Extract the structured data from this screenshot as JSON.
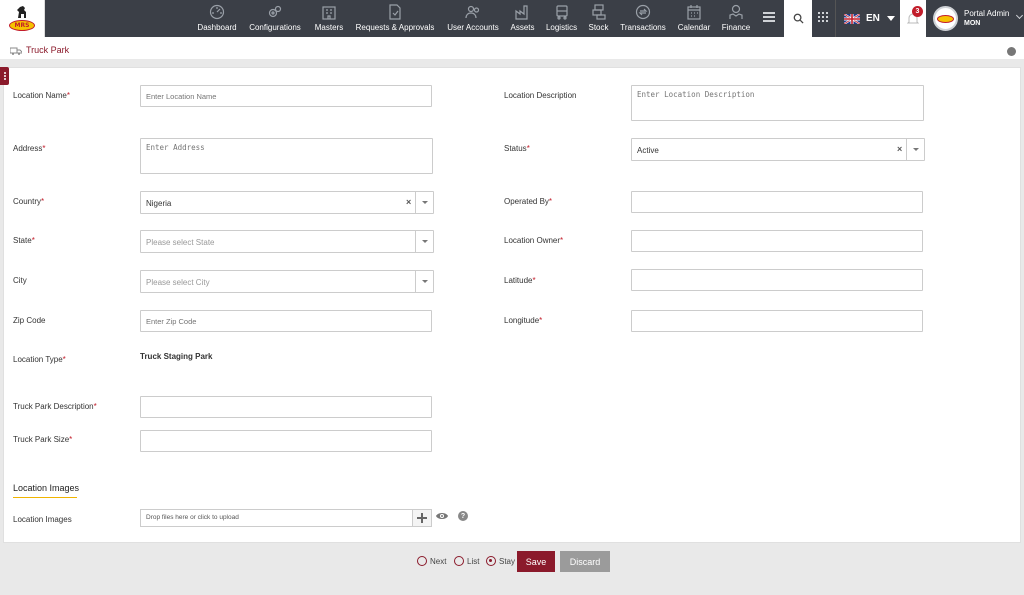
{
  "brand": {
    "logo_text": "MRS"
  },
  "nav": {
    "items": [
      {
        "label": "Dashboard",
        "icon": "dashboard-icon"
      },
      {
        "label": "Configurations",
        "icon": "gears-icon"
      },
      {
        "label": "Masters",
        "icon": "building-icon"
      },
      {
        "label": "Requests & Approvals",
        "icon": "document-check-icon"
      },
      {
        "label": "User Accounts",
        "icon": "users-icon"
      },
      {
        "label": "Assets",
        "icon": "factory-icon"
      },
      {
        "label": "Logistics",
        "icon": "truck-icon"
      },
      {
        "label": "Stock",
        "icon": "stock-icon"
      },
      {
        "label": "Transactions",
        "icon": "transactions-icon"
      },
      {
        "label": "Calendar",
        "icon": "calendar-icon"
      },
      {
        "label": "Finance",
        "icon": "finance-icon"
      }
    ],
    "language": "EN",
    "notification_count": "3",
    "user_name": "Portal Admin",
    "user_sub": "MON"
  },
  "breadcrumb": {
    "title": "Truck Park"
  },
  "form": {
    "location_name": {
      "label": "Location Name",
      "placeholder": "Enter Location Name"
    },
    "location_description": {
      "label": "Location Description",
      "placeholder": "Enter Location Description"
    },
    "address": {
      "label": "Address",
      "placeholder": "Enter Address"
    },
    "status": {
      "label": "Status",
      "value": "Active"
    },
    "country": {
      "label": "Country",
      "value": "Nigeria"
    },
    "operated_by": {
      "label": "Operated By"
    },
    "state": {
      "label": "State",
      "placeholder": "Please select State"
    },
    "location_owner": {
      "label": "Location Owner"
    },
    "city": {
      "label": "City",
      "placeholder": "Please select City"
    },
    "latitude": {
      "label": "Latitude"
    },
    "zip_code": {
      "label": "Zip Code",
      "placeholder": "Enter Zip Code"
    },
    "longitude": {
      "label": "Longitude"
    },
    "location_type": {
      "label": "Location Type",
      "value": "Truck Staging Park"
    },
    "truck_park_description": {
      "label": "Truck Park Description"
    },
    "truck_park_size": {
      "label": "Truck Park Size"
    },
    "required_mark": "*",
    "clear_mark": "×"
  },
  "images": {
    "section_title": "Location Images",
    "label": "Location Images",
    "upload_text": "Drop files here or click to upload",
    "help": "?"
  },
  "footer": {
    "radio_next": "Next",
    "radio_list": "List",
    "radio_stay": "Stay",
    "selected": "Stay",
    "save": "Save",
    "discard": "Discard"
  },
  "colors": {
    "brand": "#8b1a2b",
    "nav_bg": "#3b3f47",
    "accent": "#f0b400"
  }
}
